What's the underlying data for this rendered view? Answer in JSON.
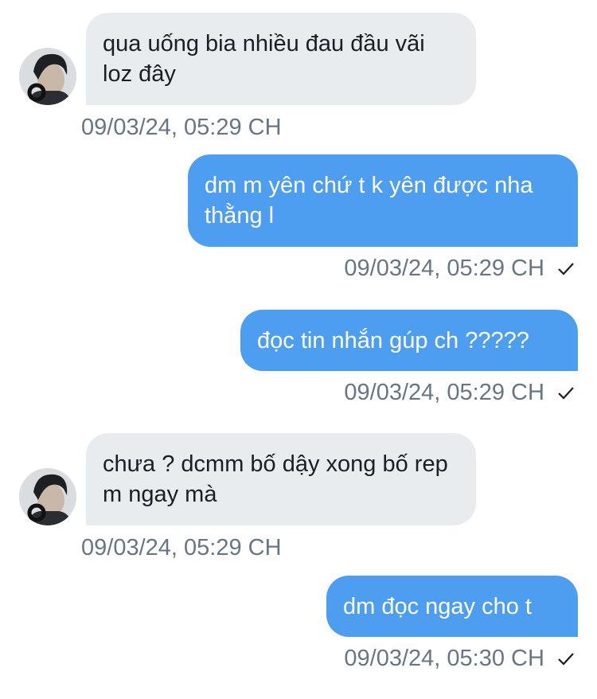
{
  "messages": [
    {
      "direction": "incoming",
      "text": "qua uống bia nhiều đau đầu vãi loz đây",
      "timestamp": "09/03/24, 05:29 CH"
    },
    {
      "direction": "outgoing",
      "text": "dm m yên chứ t k yên được nha thằng l",
      "timestamp": "09/03/24, 05:29 CH",
      "status_icon": "check-icon"
    },
    {
      "direction": "outgoing",
      "text": "đọc tin nhắn gúp ch ?????",
      "timestamp": "09/03/24, 05:29 CH",
      "status_icon": "check-icon"
    },
    {
      "direction": "incoming",
      "text": "chưa ? dcmm bố dậy xong bố rep m ngay mà",
      "timestamp": "09/03/24, 05:29 CH"
    },
    {
      "direction": "outgoing",
      "text": "dm đọc ngay cho t",
      "timestamp": "09/03/24, 05:30 CH",
      "status_icon": "check-icon"
    }
  ],
  "colors": {
    "incoming_bubble": "#e9ecef",
    "outgoing_bubble": "#4d9ef0",
    "timestamp_text": "#687684",
    "background": "#ffffff"
  }
}
